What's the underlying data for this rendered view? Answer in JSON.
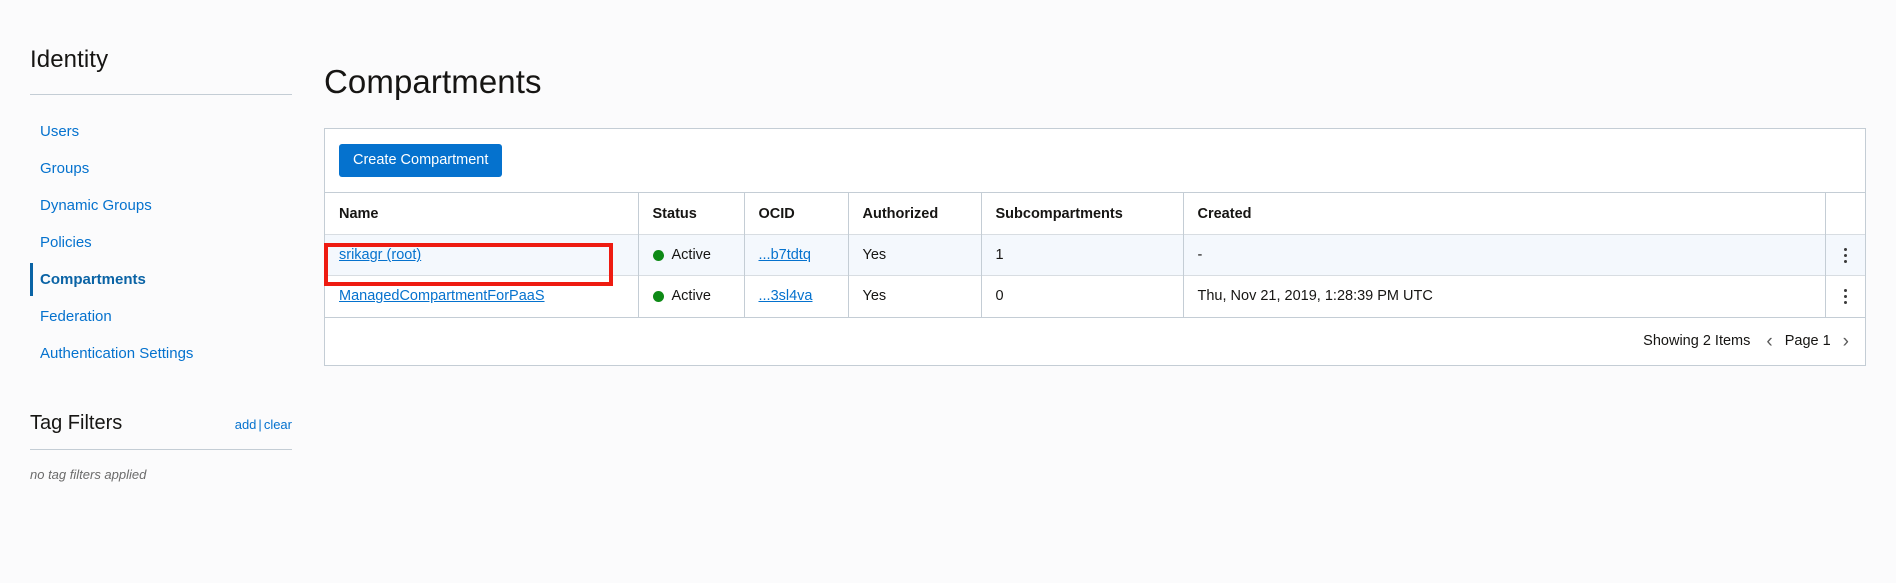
{
  "sidebar": {
    "title": "Identity",
    "items": [
      {
        "label": "Users",
        "active": false
      },
      {
        "label": "Groups",
        "active": false
      },
      {
        "label": "Dynamic Groups",
        "active": false
      },
      {
        "label": "Policies",
        "active": false
      },
      {
        "label": "Compartments",
        "active": true
      },
      {
        "label": "Federation",
        "active": false
      },
      {
        "label": "Authentication Settings",
        "active": false
      }
    ],
    "tag_filters": {
      "title": "Tag Filters",
      "add_label": "add",
      "separator": "|",
      "clear_label": "clear",
      "empty_text": "no tag filters applied"
    }
  },
  "main": {
    "page_title": "Compartments",
    "toolbar": {
      "create_label": "Create Compartment"
    },
    "table": {
      "columns": [
        "Name",
        "Status",
        "OCID",
        "Authorized",
        "Subcompartments",
        "Created"
      ],
      "rows": [
        {
          "name": "srikagr (root)",
          "status": "Active",
          "ocid": "...b7tdtq",
          "authorized": "Yes",
          "subcompartments": "1",
          "created": "-",
          "highlighted": true
        },
        {
          "name": "ManagedCompartmentForPaaS",
          "status": "Active",
          "ocid": "...3sl4va",
          "authorized": "Yes",
          "subcompartments": "0",
          "created": "Thu, Nov 21, 2019, 1:28:39 PM UTC",
          "highlighted": false
        }
      ]
    },
    "footer": {
      "showing": "Showing 2 Items",
      "prev_icon": "chevron-left-icon",
      "page_label": "Page 1",
      "next_icon": "chevron-right-icon"
    }
  },
  "annotation": {
    "type": "red-highlight-box",
    "target": "srikagr (root)"
  },
  "colors": {
    "link": "#0572ce",
    "primary_button": "#0572ce",
    "status_active": "#0e8a16",
    "annotation": "#ee1b11",
    "row_highlight": "#f4f8fd",
    "border": "#c4cdd5"
  }
}
